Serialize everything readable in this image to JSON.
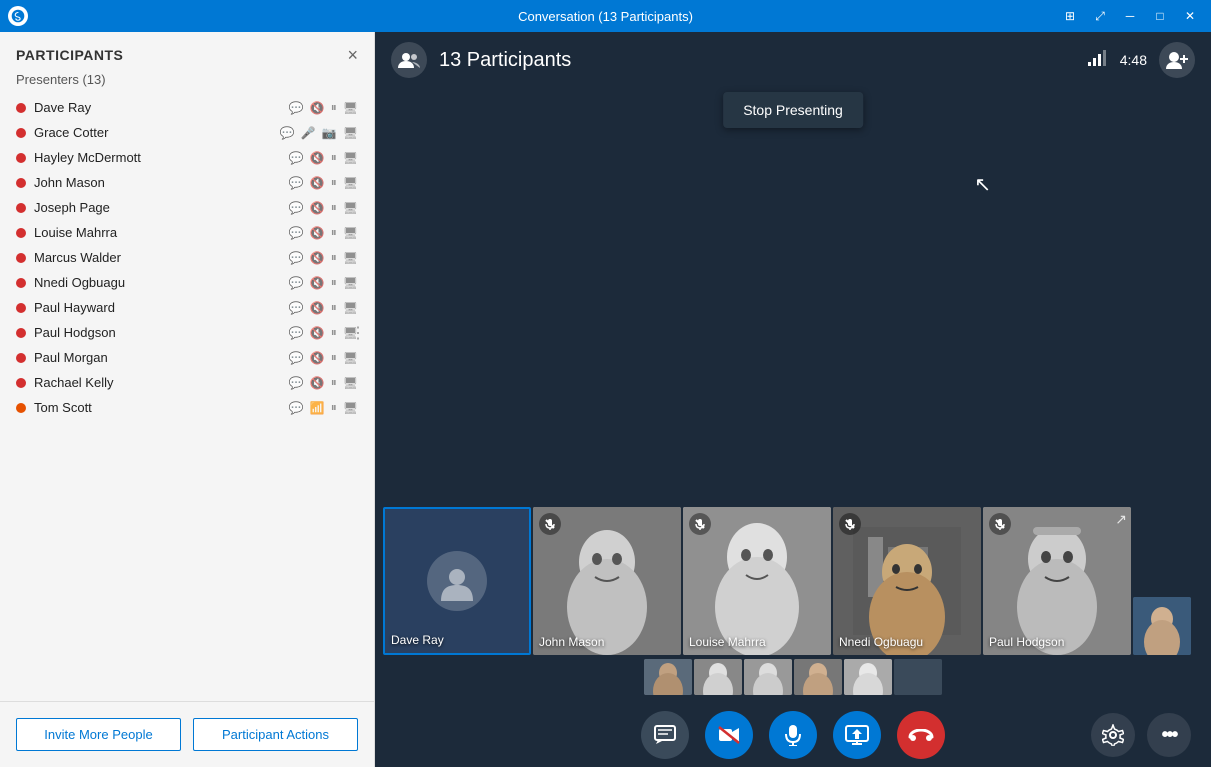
{
  "titlebar": {
    "title": "Conversation (13 Participants)",
    "logo": "skype-logo",
    "controls": [
      "grid-icon",
      "expand-icon",
      "minimize-icon",
      "maximize-icon",
      "close-icon"
    ]
  },
  "sidebar": {
    "title": "PARTICIPANTS",
    "close_label": "×",
    "presenters_label": "Presenters (13)",
    "participants": [
      {
        "name": "Dave Ray",
        "status": "red",
        "icons": [
          "chat",
          "mic-off",
          "pause",
          "screen"
        ]
      },
      {
        "name": "Grace Cotter",
        "status": "red",
        "icons": [
          "chat",
          "mic-on",
          "video",
          "screen"
        ]
      },
      {
        "name": "Hayley McDermott",
        "status": "red",
        "icons": [
          "chat",
          "mic-off",
          "pause",
          "screen"
        ]
      },
      {
        "name": "John Mason",
        "status": "red",
        "icons": [
          "chat",
          "mic-off",
          "pause",
          "screen"
        ]
      },
      {
        "name": "Joseph Page",
        "status": "red",
        "icons": [
          "chat",
          "mic-off",
          "pause",
          "screen"
        ]
      },
      {
        "name": "Louise Mahrra",
        "status": "red",
        "icons": [
          "chat",
          "mic-off",
          "pause",
          "screen"
        ]
      },
      {
        "name": "Marcus Walder",
        "status": "red",
        "icons": [
          "chat",
          "mic-off",
          "pause",
          "screen"
        ]
      },
      {
        "name": "Nnedi Ogbuagu",
        "status": "red",
        "icons": [
          "chat",
          "mic-off",
          "pause",
          "screen"
        ]
      },
      {
        "name": "Paul Hayward",
        "status": "red",
        "icons": [
          "chat",
          "mic-off",
          "pause",
          "screen"
        ]
      },
      {
        "name": "Paul Hodgson",
        "status": "red",
        "icons": [
          "chat",
          "mic-off",
          "pause",
          "screen"
        ]
      },
      {
        "name": "Paul Morgan",
        "status": "red",
        "icons": [
          "chat",
          "mic-off",
          "pause",
          "screen"
        ]
      },
      {
        "name": "Rachael Kelly",
        "status": "red",
        "icons": [
          "chat",
          "mic-off",
          "pause",
          "screen"
        ]
      },
      {
        "name": "Tom Scott",
        "status": "orange",
        "icons": [
          "chat",
          "mic-special",
          "pause",
          "screen"
        ]
      }
    ],
    "footer": {
      "invite_label": "Invite More People",
      "actions_label": "Participant Actions"
    }
  },
  "topbar": {
    "participants_count": "13 Participants",
    "timer": "4:48",
    "add_person_tooltip": "Add person"
  },
  "stop_presenting_btn": "Stop Presenting",
  "video_tiles": [
    {
      "name": "Dave Ray",
      "type": "placeholder",
      "muted": false,
      "active": true
    },
    {
      "name": "John Mason",
      "type": "photo",
      "style": "john",
      "muted": true
    },
    {
      "name": "Louise Mahrra",
      "type": "photo",
      "style": "louise",
      "muted": true
    },
    {
      "name": "Nnedi Ogbuagu",
      "type": "photo",
      "style": "nnedi",
      "muted": true
    },
    {
      "name": "Paul Hodgson",
      "type": "photo",
      "style": "paul-h",
      "muted": true
    }
  ],
  "toolbar": {
    "chat_label": "💬",
    "mute_label": "🎤",
    "screen_label": "🖥",
    "end_label": "📞",
    "settings_label": "⚙",
    "more_label": "•••"
  }
}
